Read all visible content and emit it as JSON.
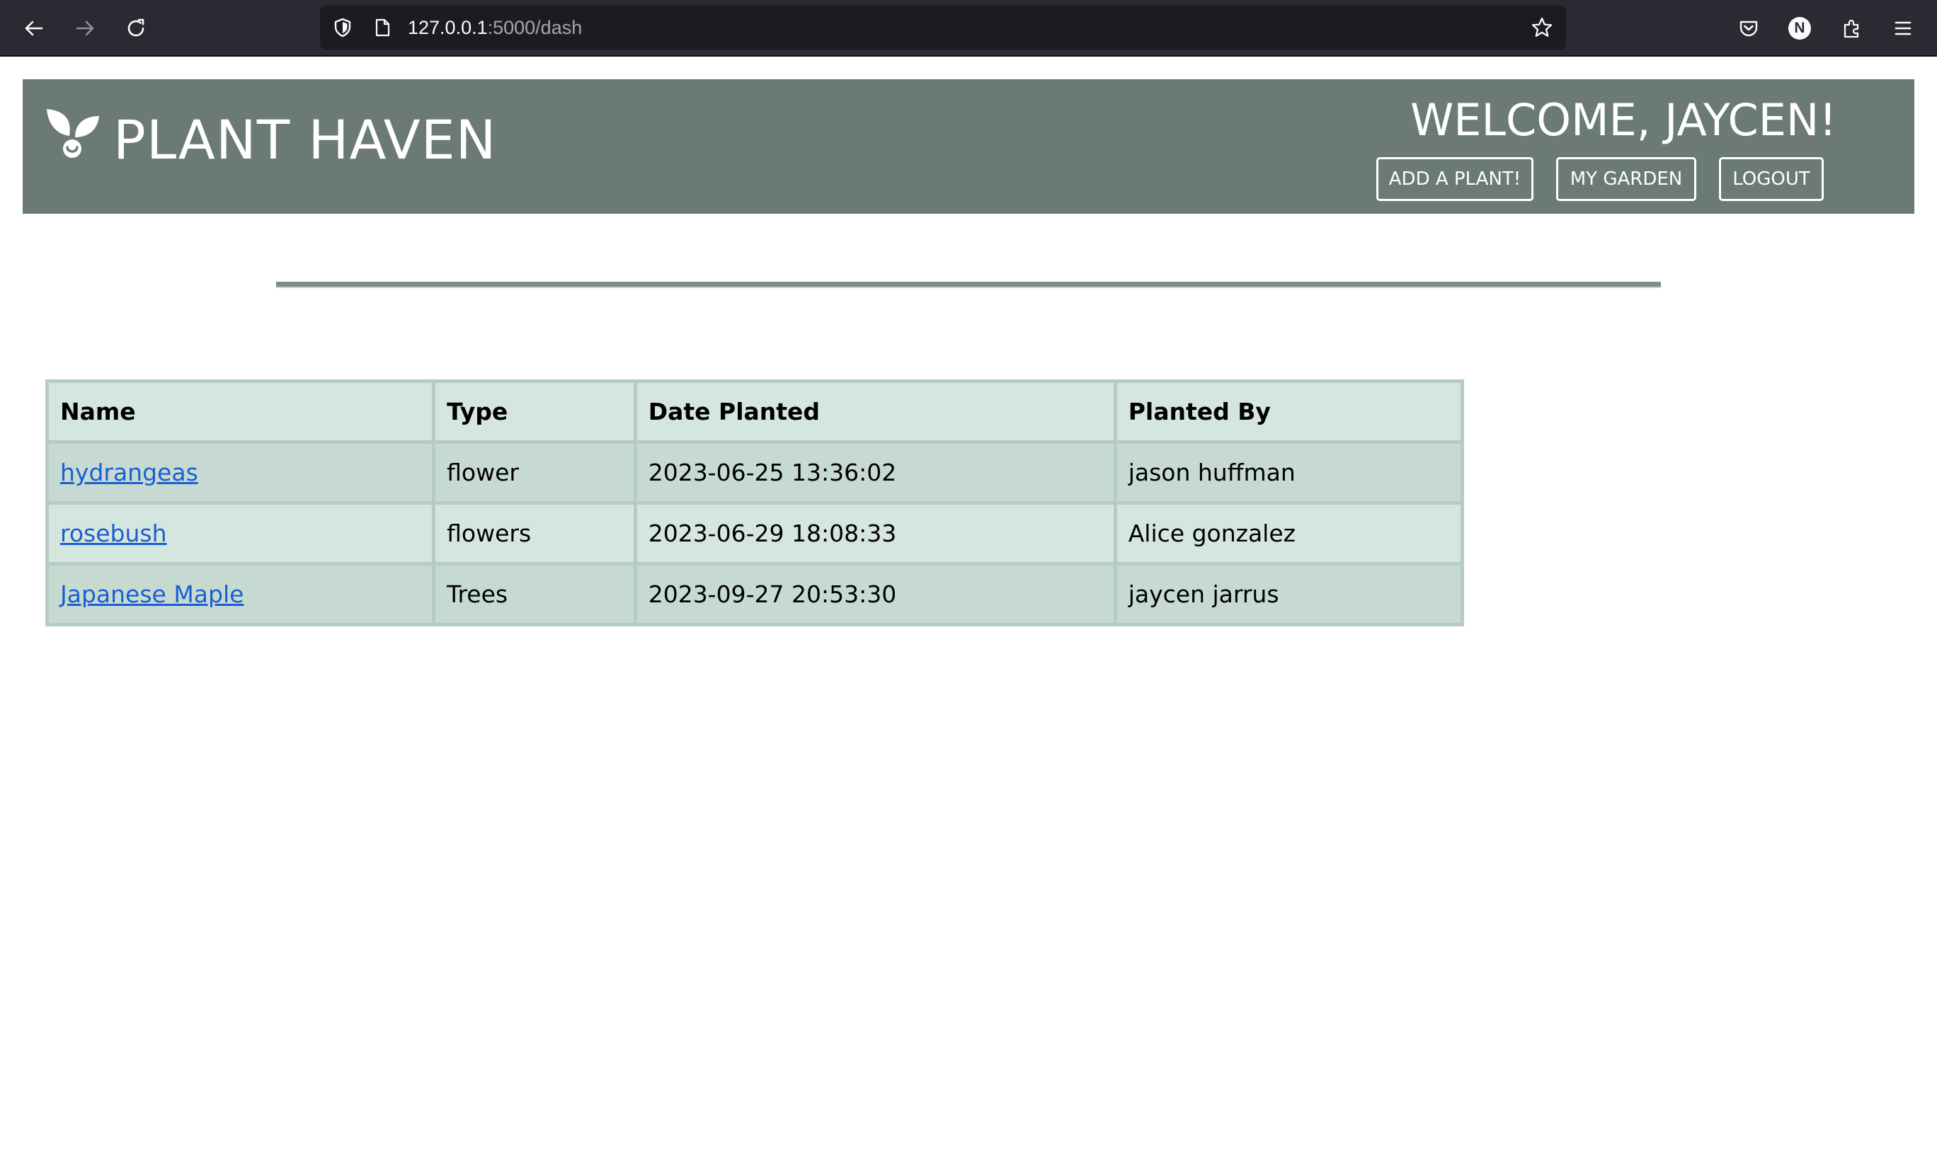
{
  "browser": {
    "url_host": "127.0.0.1",
    "url_path": ":5000/dash",
    "profile_initial": "N",
    "icons": {
      "back": "arrow-left-icon",
      "forward": "arrow-right-icon",
      "reload": "reload-icon",
      "site_info": "shield-icon",
      "page": "page-icon",
      "bookmark": "star-icon",
      "pocket": "pocket-icon",
      "extensions": "puzzle-icon",
      "menu": "hamburger-icon"
    }
  },
  "header": {
    "brand": "PLANT HAVEN",
    "logo_icon": "leaf-icon",
    "welcome": "WELCOME, JAYCEN!",
    "buttons": {
      "add_plant": "ADD A PLANT!",
      "my_garden": "MY GARDEN",
      "logout": "LOGOUT"
    }
  },
  "table": {
    "headers": {
      "name": "Name",
      "type": "Type",
      "date": "Date Planted",
      "by": "Planted By"
    },
    "rows": [
      {
        "name": "hydrangeas",
        "type": "flower",
        "date": "2023-06-25 13:36:02",
        "by": "jason huffman"
      },
      {
        "name": "rosebush",
        "type": "flowers",
        "date": "2023-06-29 18:08:33",
        "by": "Alice gonzalez"
      },
      {
        "name": "Japanese Maple",
        "type": "Trees",
        "date": "2023-09-27 20:53:30",
        "by": "jaycen jarrus"
      }
    ]
  },
  "colors": {
    "header_bg": "#6b7a74",
    "table_header_bg": "#d5e6de",
    "table_row_alt_bg": "#c7dad2",
    "link": "#1a5fd1"
  }
}
